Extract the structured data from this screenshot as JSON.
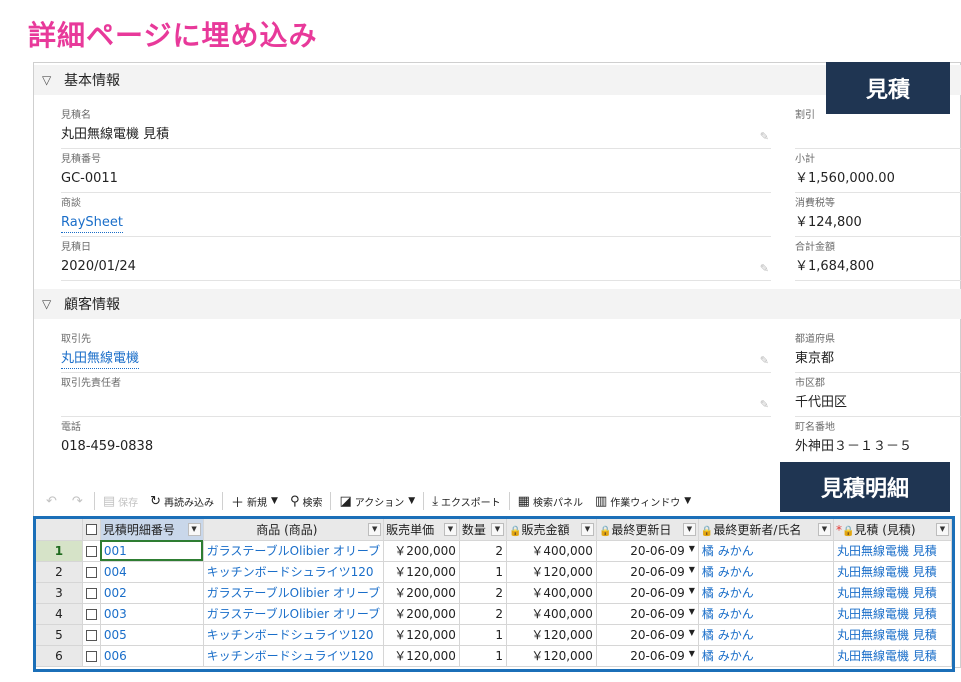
{
  "page_title": "詳細ページに埋め込み",
  "badges": {
    "quote": "見積",
    "quote_lines": "見積明細"
  },
  "sections": {
    "basic": {
      "title": "基本情報"
    },
    "customer": {
      "title": "顧客情報"
    }
  },
  "fields": {
    "quote_name": {
      "label": "見積名",
      "value": "丸田無線電機 見積"
    },
    "quote_number": {
      "label": "見積番号",
      "value": "GC-0011"
    },
    "opportunity": {
      "label": "商談",
      "value": "RaySheet"
    },
    "quote_date": {
      "label": "見積日",
      "value": "2020/01/24"
    },
    "discount": {
      "label": "割引",
      "value": ""
    },
    "subtotal": {
      "label": "小計",
      "value": "￥1,560,000.00"
    },
    "tax": {
      "label": "消費税等",
      "value": "￥124,800"
    },
    "total": {
      "label": "合計金額",
      "value": "￥1,684,800"
    },
    "account": {
      "label": "取引先",
      "value": "丸田無線電機"
    },
    "contact": {
      "label": "取引先責任者",
      "value": ""
    },
    "phone": {
      "label": "電話",
      "value": "018-459-0838"
    },
    "prefecture": {
      "label": "都道府県",
      "value": "東京都"
    },
    "city": {
      "label": "市区郡",
      "value": "千代田区"
    },
    "street": {
      "label": "町名番地",
      "value": "外神田３－１３－５"
    }
  },
  "toolbar": {
    "save": "保存",
    "reload": "再読み込み",
    "new": "新規",
    "search": "検索",
    "action": "アクション",
    "export": "エクスポート",
    "search_panel": "検索パネル",
    "work_window": "作業ウィンドウ"
  },
  "grid": {
    "columns": [
      "見積明細番号",
      "商品 (商品)",
      "販売単価",
      "数量",
      "販売金額",
      "最終更新日",
      "最終更新者/氏名",
      "見積 (見積)"
    ],
    "rows": [
      {
        "n": "1",
        "code": "001",
        "product": "ガラステーブルOlibier オリーブ",
        "price": "￥200,000",
        "qty": "2",
        "amount": "￥400,000",
        "date": "20-06-09",
        "user": "橘 みかん",
        "quote": "丸田無線電機 見積"
      },
      {
        "n": "2",
        "code": "004",
        "product": "キッチンボードシュライツ120",
        "price": "￥120,000",
        "qty": "1",
        "amount": "￥120,000",
        "date": "20-06-09",
        "user": "橘 みかん",
        "quote": "丸田無線電機 見積"
      },
      {
        "n": "3",
        "code": "002",
        "product": "ガラステーブルOlibier オリーブ",
        "price": "￥200,000",
        "qty": "2",
        "amount": "￥400,000",
        "date": "20-06-09",
        "user": "橘 みかん",
        "quote": "丸田無線電機 見積"
      },
      {
        "n": "4",
        "code": "003",
        "product": "ガラステーブルOlibier オリーブ",
        "price": "￥200,000",
        "qty": "2",
        "amount": "￥400,000",
        "date": "20-06-09",
        "user": "橘 みかん",
        "quote": "丸田無線電機 見積"
      },
      {
        "n": "5",
        "code": "005",
        "product": "キッチンボードシュライツ120",
        "price": "￥120,000",
        "qty": "1",
        "amount": "￥120,000",
        "date": "20-06-09",
        "user": "橘 みかん",
        "quote": "丸田無線電機 見積"
      },
      {
        "n": "6",
        "code": "006",
        "product": "キッチンボードシュライツ120",
        "price": "￥120,000",
        "qty": "1",
        "amount": "￥120,000",
        "date": "20-06-09",
        "user": "橘 みかん",
        "quote": "丸田無線電機 見積"
      }
    ]
  },
  "colors": {
    "title": "#e8399a",
    "badge": "#1f3552",
    "grid_frame": "#1b6fb8",
    "link": "#1a6ec9"
  }
}
